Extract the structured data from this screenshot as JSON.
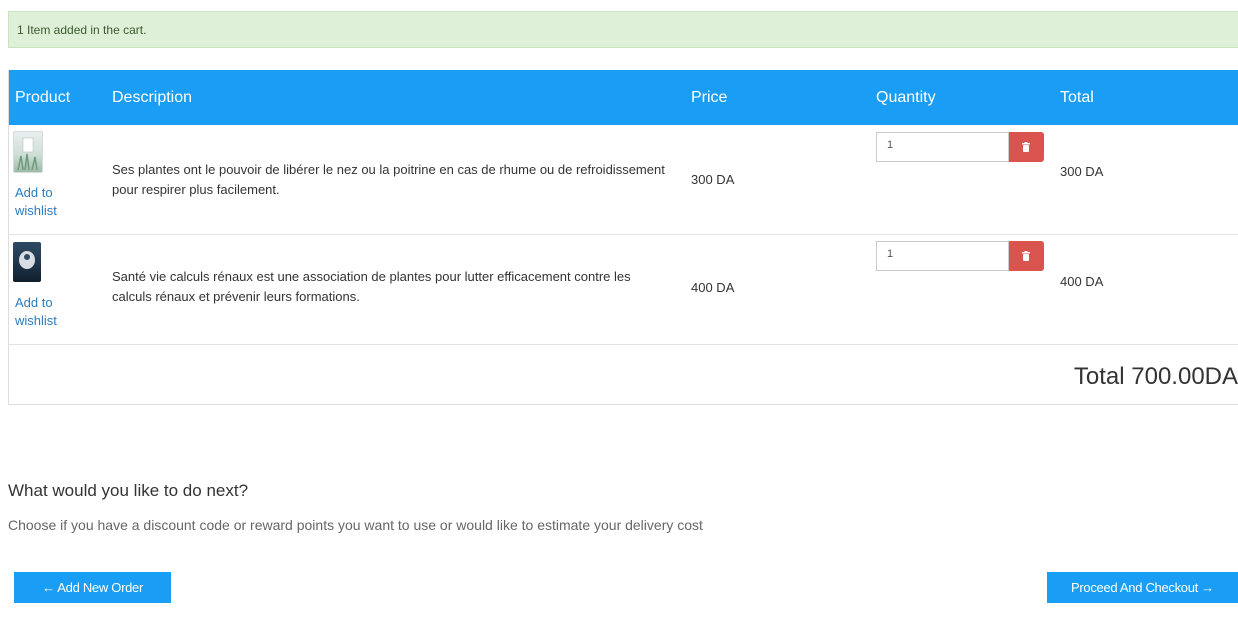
{
  "alert": {
    "message": "1 Item added in the cart."
  },
  "table": {
    "headers": {
      "product": "Product",
      "description": "Description",
      "price": "Price",
      "quantity": "Quantity",
      "total": "Total"
    },
    "rows": [
      {
        "wishlist_label": "Add to wishlist",
        "description": "Ses plantes ont le pouvoir de libérer le nez ou la poitrine en cas de rhume ou de refroidissement pour respirer plus facilement.",
        "price": "300 DA",
        "quantity": "1",
        "total": "300 DA"
      },
      {
        "wishlist_label": "Add to wishlist",
        "description": "Santé vie calculs rénaux est une association de plantes pour lutter efficacement contre les calculs rénaux et prévenir leurs formations.",
        "price": "400 DA",
        "quantity": "1",
        "total": "400 DA"
      }
    ],
    "grand_total": "Total 700.00DA"
  },
  "next": {
    "title": "What would you like to do next?",
    "subtitle": "Choose if you have a discount code or reward points you want to use or would like to estimate your delivery cost"
  },
  "buttons": {
    "add_order": "Add New Order",
    "checkout": "Proceed And Checkout"
  },
  "icons": {
    "add_order_icon": "arrow-left-icon",
    "checkout_icon": "arrow-right-icon",
    "delete_icon": "trash-icon"
  },
  "colors": {
    "header_bg": "#1a9df5",
    "alert_bg": "#dff0d8",
    "delete_bg": "#d9534f",
    "link": "#2a7bc0"
  }
}
